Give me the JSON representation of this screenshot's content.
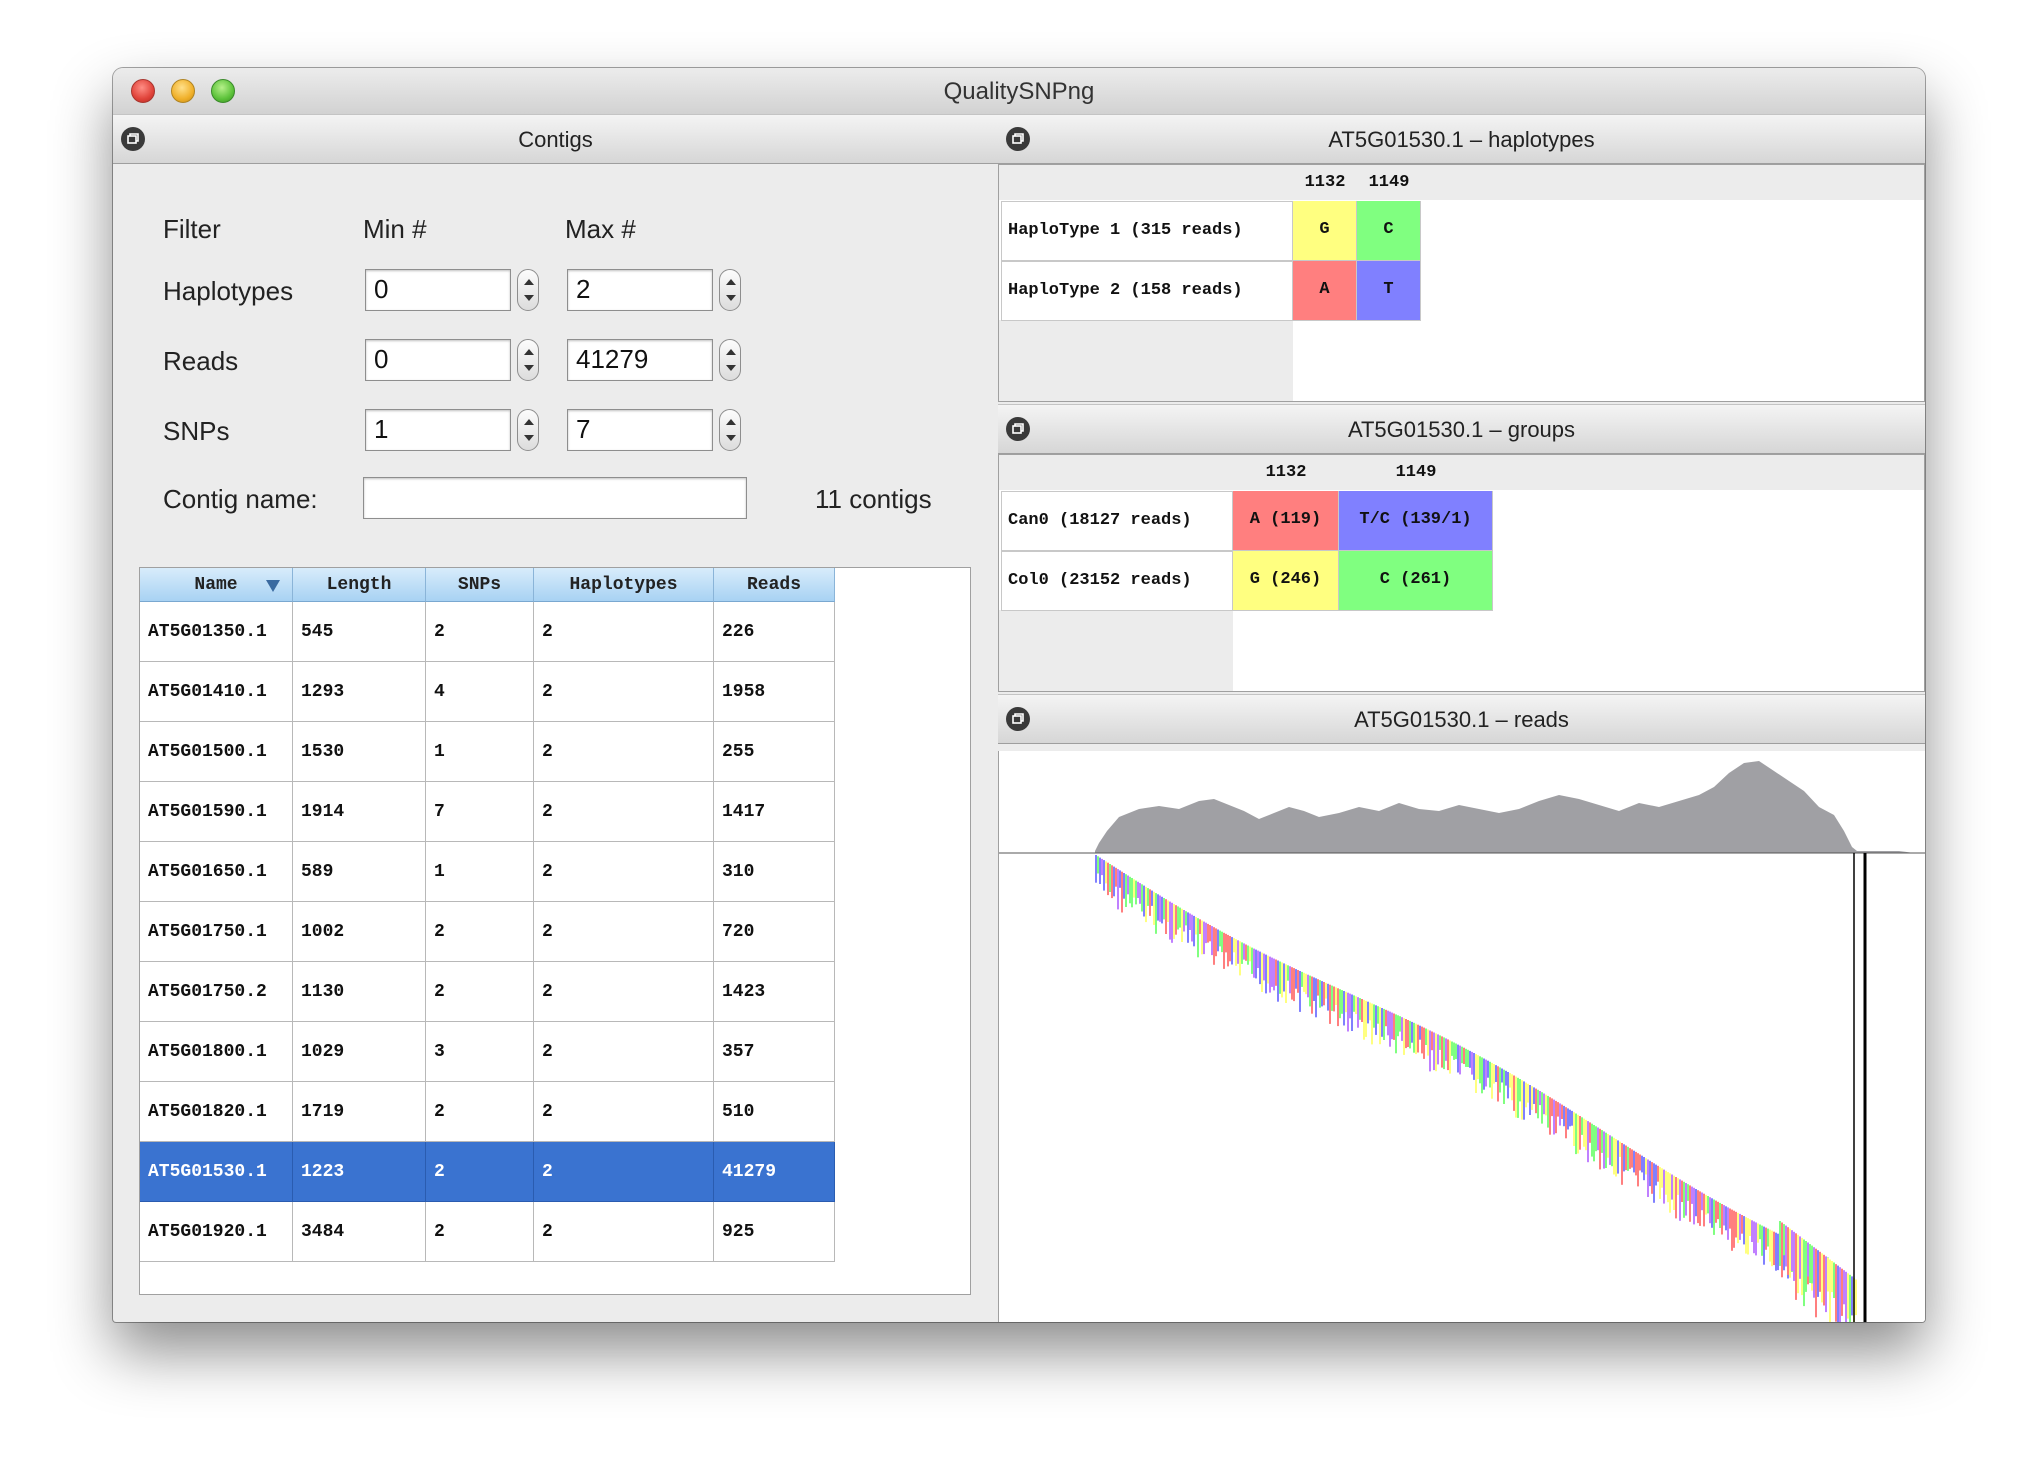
{
  "window": {
    "title": "QualitySNPng"
  },
  "contigs_panel": {
    "title": "Contigs",
    "filter_label": "Filter",
    "min_label": "Min #",
    "max_label": "Max #",
    "rows": [
      {
        "label": "Haplotypes",
        "min": "0",
        "max": "2"
      },
      {
        "label": "Reads",
        "min": "0",
        "max": "41279"
      },
      {
        "label": "SNPs",
        "min": "1",
        "max": "7"
      }
    ],
    "contig_name_label": "Contig name:",
    "contig_name_value": "",
    "count_text": "11 contigs"
  },
  "table": {
    "columns": [
      "Name",
      "Length",
      "SNPs",
      "Haplotypes",
      "Reads"
    ],
    "sort_column": "Name",
    "rows": [
      [
        "AT5G01350.1",
        "545",
        "2",
        "2",
        "226"
      ],
      [
        "AT5G01410.1",
        "1293",
        "4",
        "2",
        "1958"
      ],
      [
        "AT5G01500.1",
        "1530",
        "1",
        "2",
        "255"
      ],
      [
        "AT5G01590.1",
        "1914",
        "7",
        "2",
        "1417"
      ],
      [
        "AT5G01650.1",
        "589",
        "1",
        "2",
        "310"
      ],
      [
        "AT5G01750.1",
        "1002",
        "2",
        "2",
        "720"
      ],
      [
        "AT5G01750.2",
        "1130",
        "2",
        "2",
        "1423"
      ],
      [
        "AT5G01800.1",
        "1029",
        "3",
        "2",
        "357"
      ],
      [
        "AT5G01820.1",
        "1719",
        "2",
        "2",
        "510"
      ],
      [
        "AT5G01530.1",
        "1223",
        "2",
        "2",
        "41279"
      ],
      [
        "AT5G01920.1",
        "3484",
        "2",
        "2",
        "925"
      ]
    ],
    "selected_row": 9
  },
  "haplotypes_panel": {
    "title": "AT5G01530.1 – haplotypes",
    "positions": [
      "1132",
      "1149"
    ],
    "rows": [
      {
        "label": "HaploType 1 (315 reads)",
        "cells": [
          {
            "text": "G",
            "color": "#ffff80"
          },
          {
            "text": "C",
            "color": "#80ff80"
          }
        ]
      },
      {
        "label": "HaploType 2 (158 reads)",
        "cells": [
          {
            "text": "A",
            "color": "#ff7f7f"
          },
          {
            "text": "T",
            "color": "#8080ff"
          }
        ]
      }
    ]
  },
  "groups_panel": {
    "title": "AT5G01530.1 – groups",
    "positions": [
      "1132",
      "1149"
    ],
    "rows": [
      {
        "label": "Can0 (18127 reads)",
        "cells": [
          {
            "text": "A (119)",
            "color": "#ff7f7f"
          },
          {
            "text": "T/C (139/1)",
            "color": "#8080ff"
          }
        ]
      },
      {
        "label": "Col0 (23152 reads)",
        "cells": [
          {
            "text": "G (246)",
            "color": "#ffff80"
          },
          {
            "text": "C (261)",
            "color": "#80ff80"
          }
        ]
      }
    ]
  },
  "reads_panel": {
    "title": "AT5G01530.1 – reads",
    "coverage_color": "#a0a0a4",
    "base_colors": [
      "#ff7f7f",
      "#80ff80",
      "#8080ff",
      "#ffff80",
      "#c080ff"
    ]
  }
}
